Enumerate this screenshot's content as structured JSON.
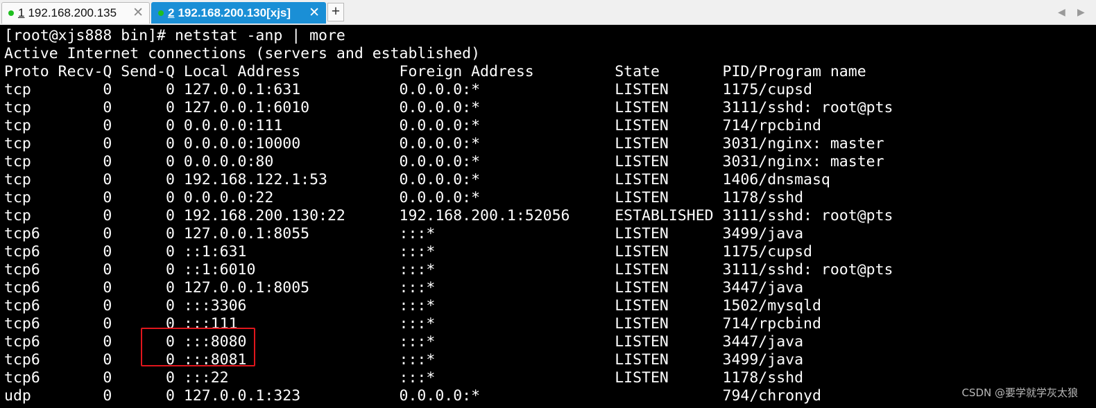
{
  "tabs": [
    {
      "num": "1",
      "label": "192.168.200.135",
      "active": false,
      "close": "✕"
    },
    {
      "num": "2",
      "label": "192.168.200.130[xjs]",
      "active": true,
      "close": "✕"
    }
  ],
  "new_tab_label": "+",
  "nav": {
    "left": "◀",
    "right": "▶"
  },
  "terminal": {
    "lines": [
      "[root@xjs888 bin]# netstat -anp | more",
      "Active Internet connections (servers and established)",
      "Proto Recv-Q Send-Q Local Address           Foreign Address         State       PID/Program name",
      "tcp        0      0 127.0.0.1:631           0.0.0.0:*               LISTEN      1175/cupsd",
      "tcp        0      0 127.0.0.1:6010          0.0.0.0:*               LISTEN      3111/sshd: root@pts",
      "tcp        0      0 0.0.0.0:111             0.0.0.0:*               LISTEN      714/rpcbind",
      "tcp        0      0 0.0.0.0:10000           0.0.0.0:*               LISTEN      3031/nginx: master",
      "tcp        0      0 0.0.0.0:80              0.0.0.0:*               LISTEN      3031/nginx: master",
      "tcp        0      0 192.168.122.1:53        0.0.0.0:*               LISTEN      1406/dnsmasq",
      "tcp        0      0 0.0.0.0:22              0.0.0.0:*               LISTEN      1178/sshd",
      "tcp        0      0 192.168.200.130:22      192.168.200.1:52056     ESTABLISHED 3111/sshd: root@pts",
      "tcp6       0      0 127.0.0.1:8055          :::*                    LISTEN      3499/java",
      "tcp6       0      0 ::1:631                 :::*                    LISTEN      1175/cupsd",
      "tcp6       0      0 ::1:6010                :::*                    LISTEN      3111/sshd: root@pts",
      "tcp6       0      0 127.0.0.1:8005          :::*                    LISTEN      3447/java",
      "tcp6       0      0 :::3306                 :::*                    LISTEN      1502/mysqld",
      "tcp6       0      0 :::111                  :::*                    LISTEN      714/rpcbind",
      "tcp6       0      0 :::8080                 :::*                    LISTEN      3447/java",
      "tcp6       0      0 :::8081                 :::*                    LISTEN      3499/java",
      "tcp6       0      0 :::22                   :::*                    LISTEN      1178/sshd",
      "udp        0      0 127.0.0.1:323           0.0.0.0:*                           794/chronyd"
    ]
  },
  "colors": {
    "terminal_background": "#000000",
    "terminal_text": "#ffffff",
    "active_tab": "#1a8fd6",
    "connected_dot": "#1fbf1f",
    "highlight_box": "#e0161c"
  },
  "watermark": "CSDN @要学就学灰太狼"
}
